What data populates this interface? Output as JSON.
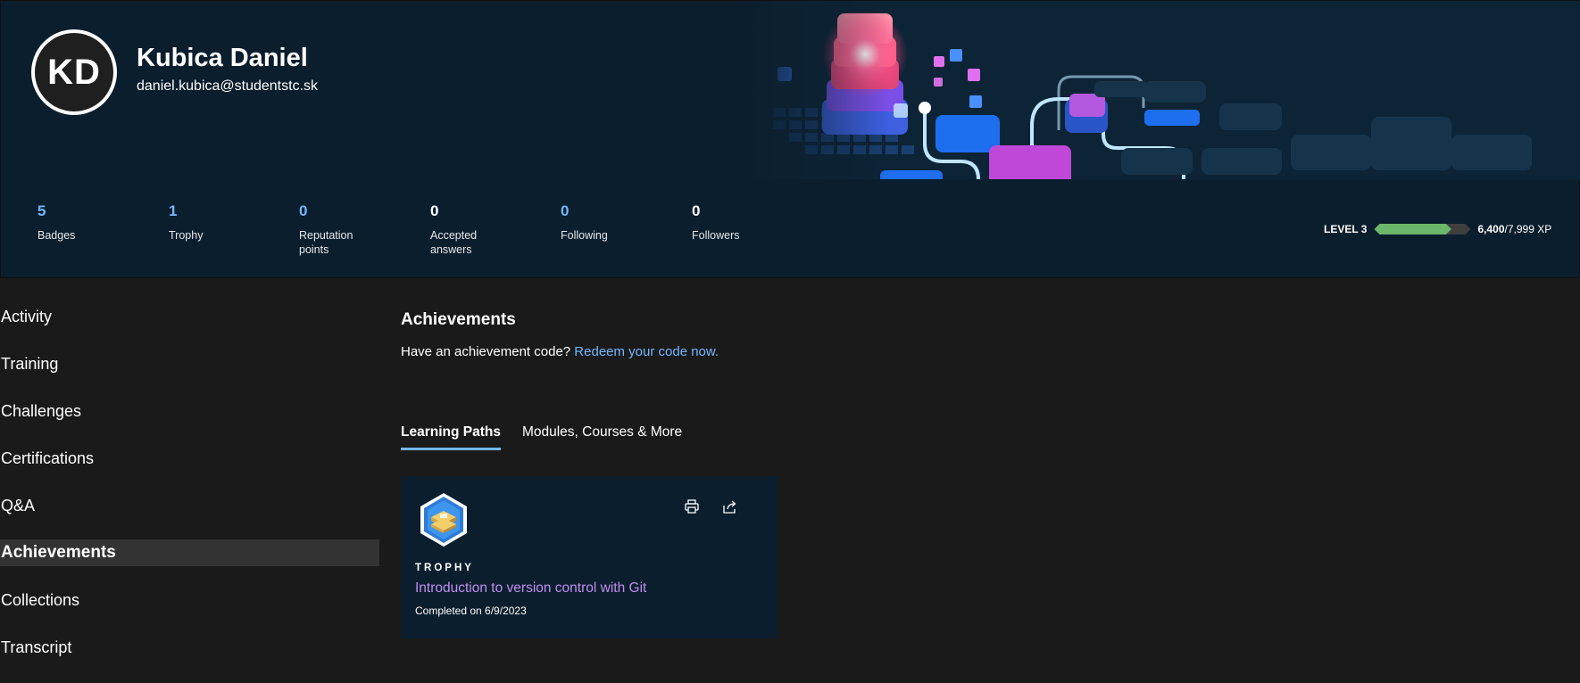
{
  "profile": {
    "initials": "KD",
    "name": "Kubica Daniel",
    "email": "daniel.kubica@studentstc.sk"
  },
  "stats": [
    {
      "value": "5",
      "label": "Badges"
    },
    {
      "value": "1",
      "label": "Trophy"
    },
    {
      "value": "0",
      "label": "Reputation\npoints"
    },
    {
      "value": "0",
      "label": "Accepted\nanswers"
    },
    {
      "value": "0",
      "label": "Following"
    },
    {
      "value": "0",
      "label": "Followers"
    }
  ],
  "level": {
    "label": "LEVEL 3",
    "current_xp": "6,400",
    "total_xp": "/7,999 XP",
    "progress": 0.8
  },
  "sidebar": {
    "items": [
      {
        "label": "Activity"
      },
      {
        "label": "Training"
      },
      {
        "label": "Challenges"
      },
      {
        "label": "Certifications"
      },
      {
        "label": "Q&A"
      },
      {
        "label": "Achievements"
      },
      {
        "label": "Collections"
      },
      {
        "label": "Transcript"
      }
    ]
  },
  "main": {
    "title": "Achievements",
    "code_prompt": "Have an achievement code? ",
    "code_link": "Redeem your code now.",
    "tabs": [
      {
        "label": "Learning Paths"
      },
      {
        "label": "Modules, Courses & More"
      }
    ],
    "card": {
      "type": "TROPHY",
      "title": "Introduction to version control with Git",
      "completed": "Completed on 6/9/2023",
      "actions": [
        "printer-icon",
        "share-icon"
      ]
    }
  },
  "colors": {
    "header_bg": "#0b1e2d",
    "page_bg": "#1a1a1a",
    "accent_blue": "#75b6ff",
    "link_purple": "#c08ef0",
    "xp_green": "#6bb76b"
  }
}
